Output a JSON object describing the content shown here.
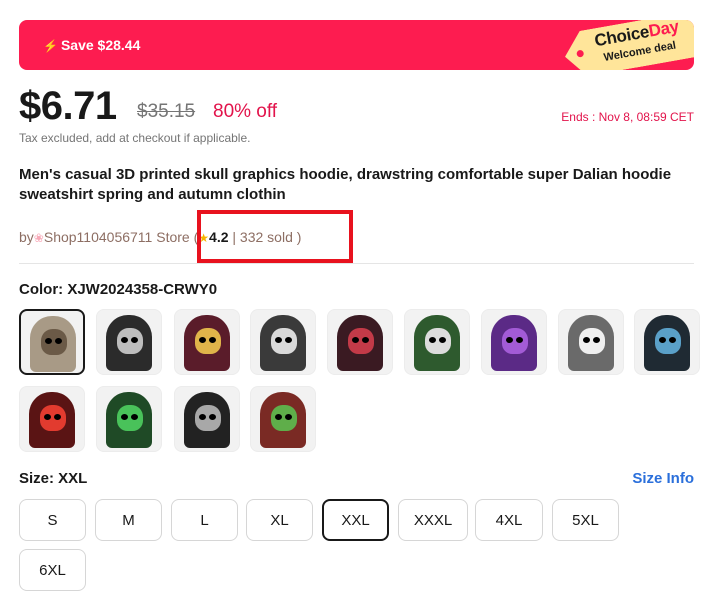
{
  "banner": {
    "save_text": "Save $28.44",
    "tag_choice": "Choice",
    "tag_day": "Day",
    "tag_sub": "Welcome deal"
  },
  "price": {
    "current": "$6.71",
    "original": "$35.15",
    "discount": "80% off",
    "ends": "Ends :  Nov 8, 08:59 CET",
    "tax_note": "Tax excluded, add at checkout if applicable."
  },
  "product": {
    "title": "Men's casual 3D printed skull graphics hoodie, drawstring comfortable super Dalian hoodie sweatshirt spring and autumn clothin"
  },
  "store": {
    "by": "by",
    "name": "Shop1104056711 Store",
    "open_paren": " (",
    "rating": "4.2",
    "separator": " | ",
    "sold": "332 sold )"
  },
  "color": {
    "label": "Color: XJW2024358-CRWY0",
    "selected_index": 0,
    "swatches": [
      {
        "hood": "#a89a86",
        "face": "#6b5a47"
      },
      {
        "hood": "#2b2b2b",
        "face": "#bdbdbd"
      },
      {
        "hood": "#5a1c2a",
        "face": "#e0b44a"
      },
      {
        "hood": "#3a3a3a",
        "face": "#d9d9d9"
      },
      {
        "hood": "#3a1a22",
        "face": "#c23a48"
      },
      {
        "hood": "#2e5a2e",
        "face": "#dcdcdc"
      },
      {
        "hood": "#5b2a86",
        "face": "#a35bd6"
      },
      {
        "hood": "#6a6a6a",
        "face": "#efefef"
      },
      {
        "hood": "#1f2a33",
        "face": "#5aa0c8"
      },
      {
        "hood": "#5a1414",
        "face": "#e23b2f"
      },
      {
        "hood": "#1f4a26",
        "face": "#49c25a"
      },
      {
        "hood": "#222222",
        "face": "#a8a8a8"
      },
      {
        "hood": "#7a2a24",
        "face": "#5fae4a"
      }
    ]
  },
  "size": {
    "label": "Size: XXL",
    "info_link": "Size Info",
    "selected": "XXL",
    "options": [
      "S",
      "M",
      "L",
      "XL",
      "XXL",
      "XXXL",
      "4XL",
      "5XL",
      "6XL"
    ]
  }
}
